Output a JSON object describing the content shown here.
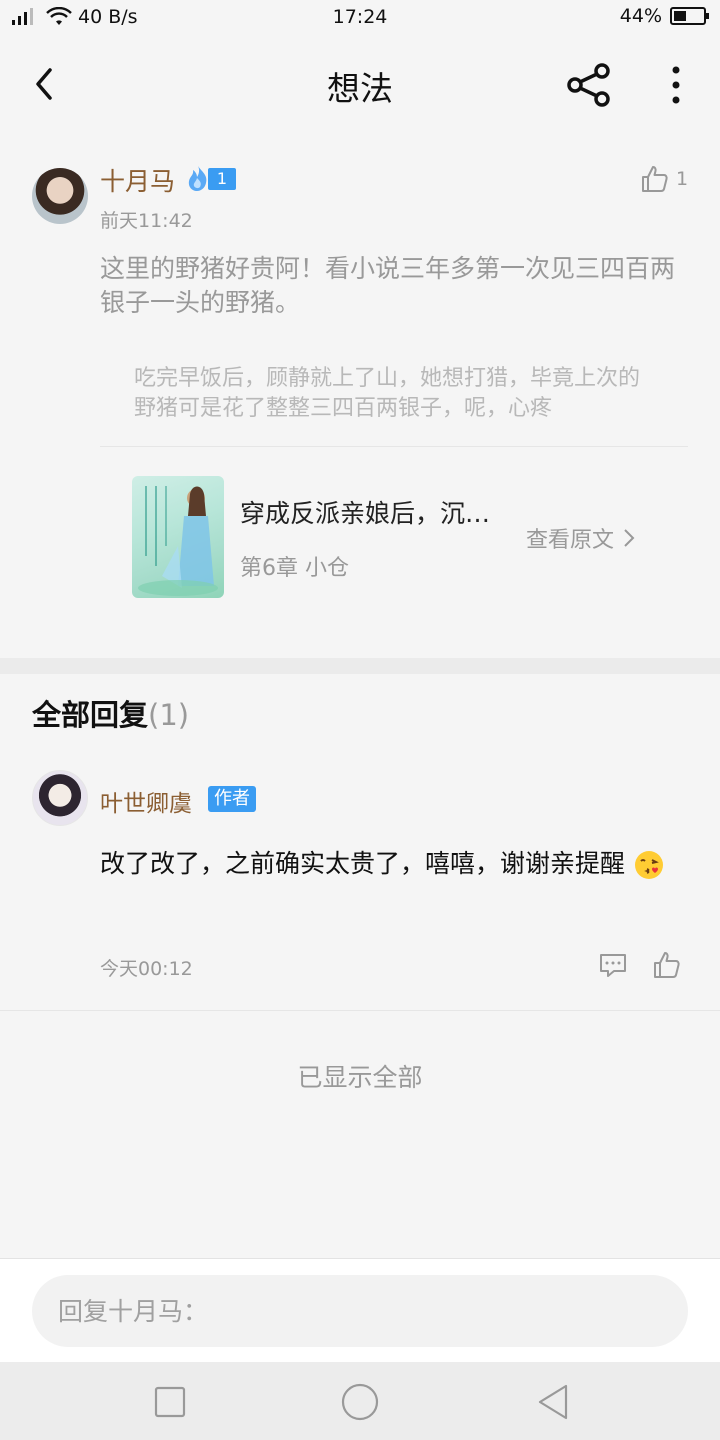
{
  "status_bar": {
    "network_speed": "40 B/s",
    "time": "17:24",
    "battery_percent": "44%",
    "battery_level": 0.44
  },
  "header": {
    "title": "想法"
  },
  "post": {
    "username": "十月马",
    "level": "1",
    "timestamp": "前天11:42",
    "like_count": "1",
    "content": "这里的野猪好贵阿！看小说三年多第一次见三四百两银子一头的野猪。",
    "quote": "吃完早饭后，顾静就上了山，她想打猎，毕竟上次的野猪可是花了整整三四百两银子，呢，心疼"
  },
  "book": {
    "title": "穿成反派亲娘后，沉…",
    "chapter": "第6章 小仓",
    "view_original": "查看原文"
  },
  "replies": {
    "header": "全部回复",
    "count": "(1)",
    "items": [
      {
        "username": "叶世卿虞",
        "badge": "作者",
        "content": "改了改了，之前确实太贵了，嘻嘻，谢谢亲提醒",
        "timestamp": "今天00:12"
      }
    ],
    "all_shown": "已显示全部"
  },
  "reply_input": {
    "placeholder": "回复十月马："
  },
  "colors": {
    "username": "#8b5e32",
    "badge_blue": "#3a9cf2",
    "muted_text": "#999999"
  }
}
